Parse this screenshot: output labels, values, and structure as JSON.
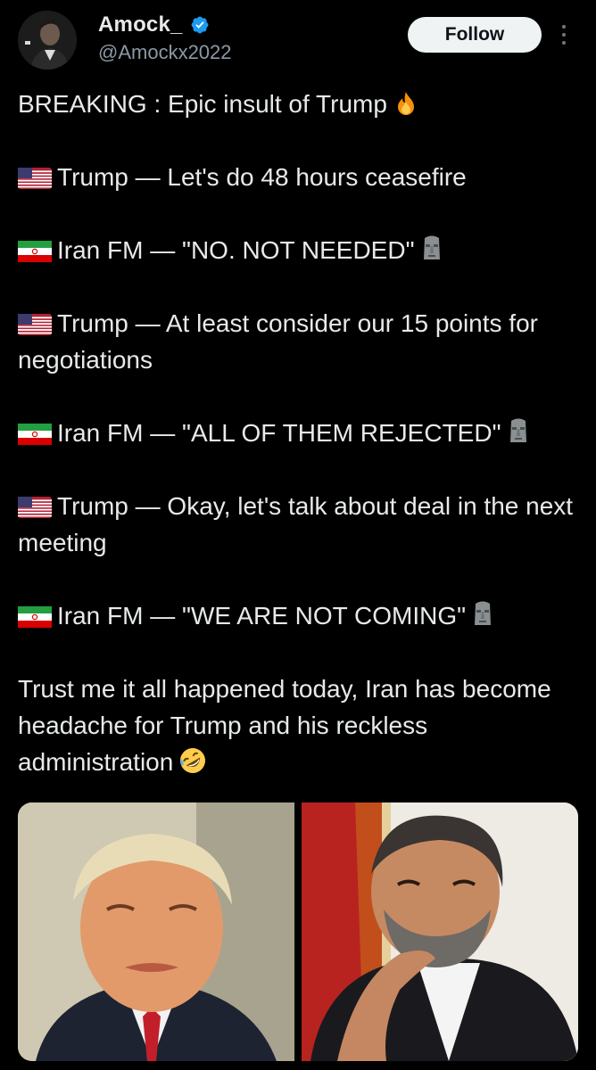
{
  "user": {
    "display_name": "Amock_",
    "handle": "@Amockx2022",
    "verified": true,
    "avatar_icon": "avatar-photo"
  },
  "actions": {
    "follow_label": "Follow",
    "more_icon": "more-vertical-icon"
  },
  "tweet": {
    "headline": "BREAKING : Epic insult of Trump",
    "headline_emoji": "fire",
    "lines": [
      {
        "flag": "us",
        "text": "Trump — Let's do 48 hours ceasefire",
        "emoji": ""
      },
      {
        "flag": "iran",
        "text": "Iran FM — \"NO. NOT NEEDED\"",
        "emoji": "moai"
      },
      {
        "flag": "us",
        "text": "Trump — At least consider our 15 points for negotiations",
        "emoji": ""
      },
      {
        "flag": "iran",
        "text": "Iran FM — \"ALL OF THEM REJECTED\"",
        "emoji": "moai"
      },
      {
        "flag": "us",
        "text": "Trump — Okay, let's talk about deal in the next meeting",
        "emoji": ""
      },
      {
        "flag": "iran",
        "text": "Iran FM — \"WE ARE NOT COMING\"",
        "emoji": "moai"
      }
    ],
    "closing": "Trust me it all happened today, Iran has become headache for Trump and his reckless administration",
    "closing_emoji": "rofl"
  },
  "media": {
    "images": [
      {
        "subject": "trump-photo"
      },
      {
        "subject": "iran-fm-photo"
      }
    ]
  }
}
